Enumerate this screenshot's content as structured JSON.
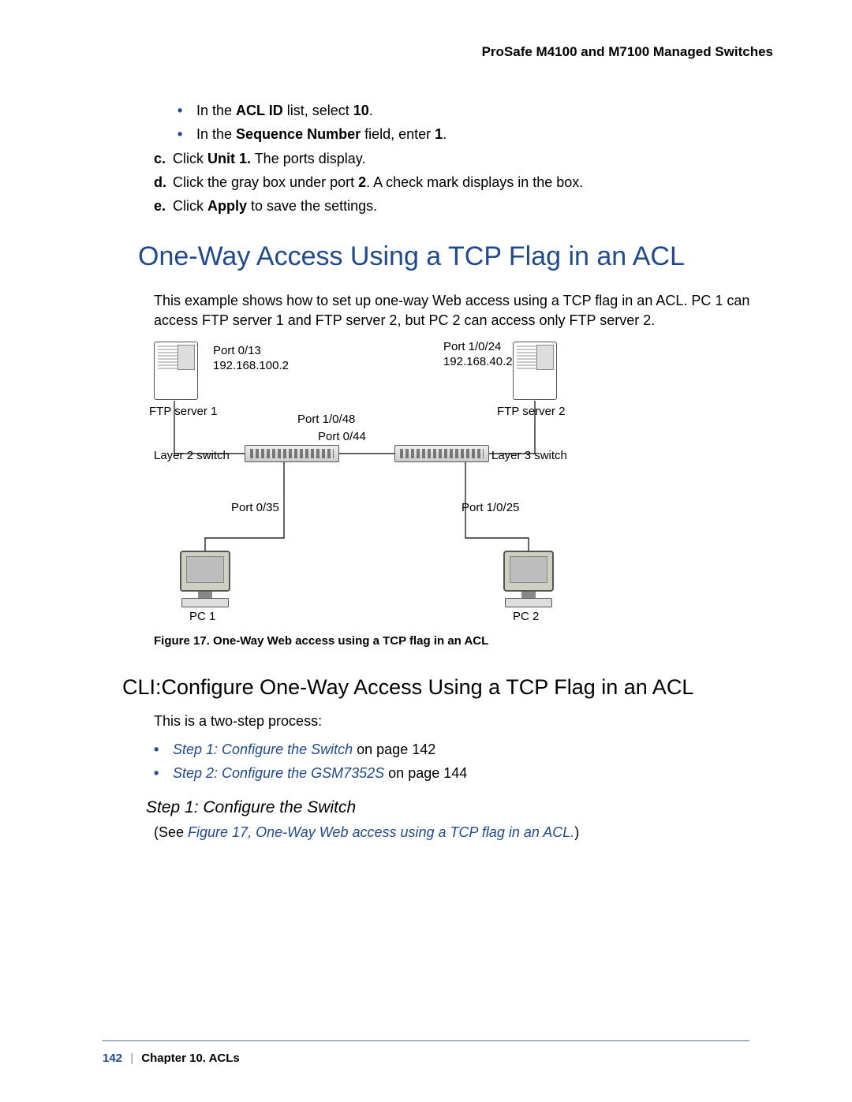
{
  "header": {
    "title": "ProSafe M4100 and M7100 Managed Switches"
  },
  "intro_bullets": [
    {
      "pre": "In the ",
      "bold": "ACL ID",
      "mid": " list, select ",
      "bold2": "10",
      "post": "."
    },
    {
      "pre": "In the ",
      "bold": "Sequence Number",
      "mid": " field, enter ",
      "bold2": "1",
      "post": "."
    }
  ],
  "steps": [
    {
      "label": "c.",
      "pre": "Click ",
      "bold": "Unit 1.",
      "post": " The ports display."
    },
    {
      "label": "d.",
      "pre": "Click the gray box under port ",
      "bold": "2",
      "post": ". A check mark displays in the box."
    },
    {
      "label": "e.",
      "pre": "Click ",
      "bold": "Apply",
      "post": " to save the settings."
    }
  ],
  "h1": "One-Way Access Using a TCP Flag in an ACL",
  "p1": "This example shows how to set up one-way Web access using a TCP flag in an ACL. PC 1 can access FTP server 1 and FTP server 2, but PC 2 can access only FTP server 2.",
  "figure": {
    "server1_port": "Port 0/13",
    "server1_ip": "192.168.100.2",
    "server1_lbl": "FTP server 1",
    "server2_port": "Port 1/0/24",
    "server2_ip": "192.168.40.2",
    "server2_lbl": "FTP server 2",
    "sw_left": "Layer 2 switch",
    "sw_right": "Layer 3 switch",
    "trunk_left": "Port 0/44",
    "trunk_right": "Port 1/0/48",
    "pc1_port": "Port 0/35",
    "pc2_port": "Port 1/0/25",
    "pc1": "PC 1",
    "pc2": "PC 2"
  },
  "figcaption": "Figure 17. One-Way Web access using a TCP flag in an ACL",
  "h2": "CLI:Configure One-Way Access Using a TCP Flag in an ACL",
  "p2": "This is a two-step process:",
  "process": [
    {
      "link": "Step 1: Configure the Switch",
      "tail": " on page 142"
    },
    {
      "link": "Step 2: Configure the GSM7352S",
      "tail": " on page 144"
    }
  ],
  "h3": "Step 1: Configure the Switch",
  "see_pre": "(See ",
  "see_link": "Figure 17, One-Way Web access using a TCP flag in an ACL.",
  "see_post": ")",
  "footer": {
    "page": "142",
    "chapter": "Chapter 10.  ACLs"
  }
}
